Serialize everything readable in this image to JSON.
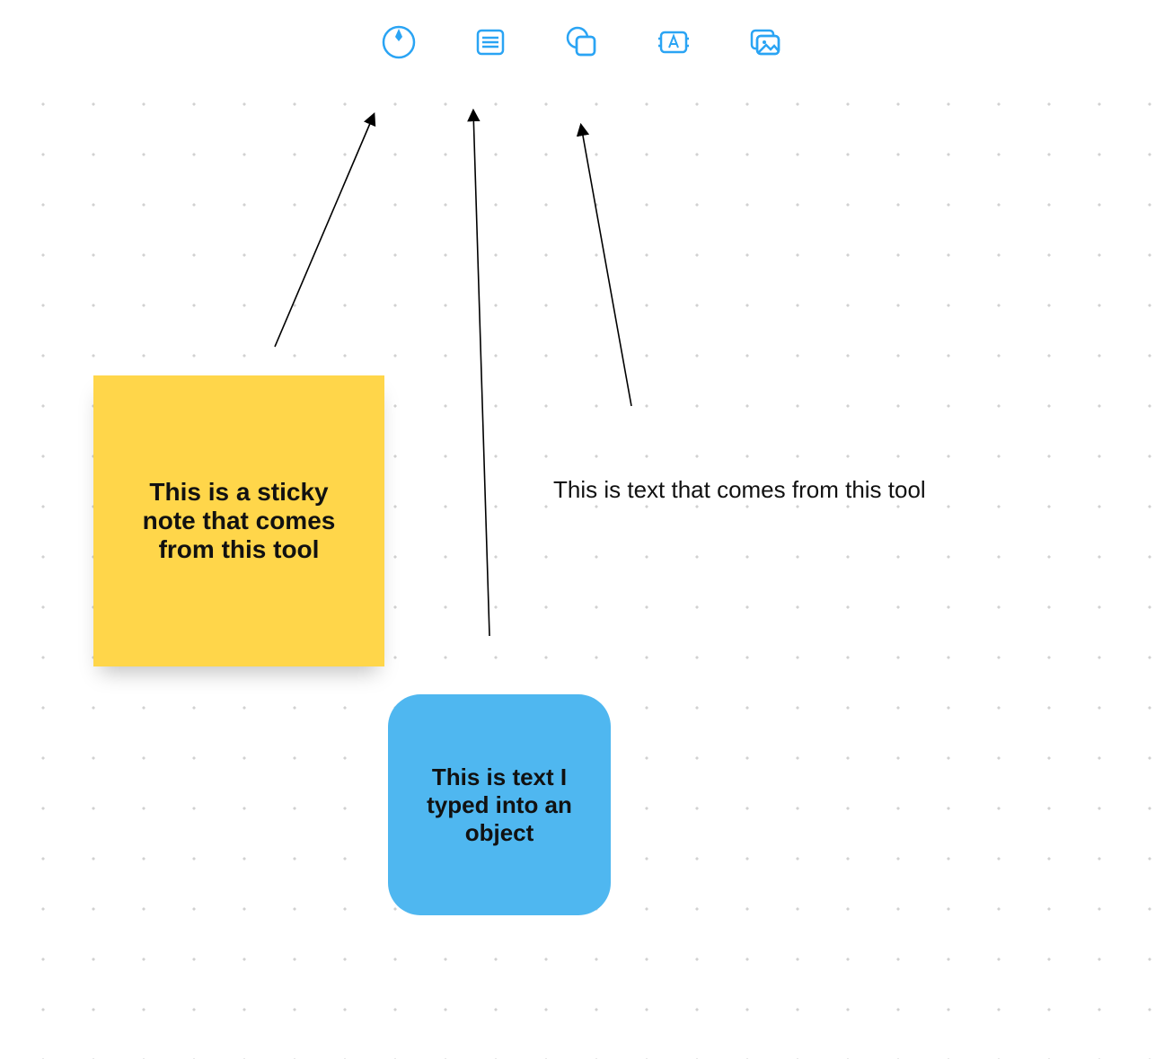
{
  "toolbar": {
    "tools": [
      {
        "name": "pen-tool",
        "icon": "pen"
      },
      {
        "name": "sticky-tool",
        "icon": "sticky"
      },
      {
        "name": "shape-tool",
        "icon": "shape"
      },
      {
        "name": "text-tool",
        "icon": "text"
      },
      {
        "name": "image-tool",
        "icon": "image"
      }
    ]
  },
  "canvas": {
    "sticky_note_text": "This is a sticky note that comes from this tool",
    "shape_text": "This is text I typed into an object",
    "text_block_text": "This is text that comes from this tool"
  },
  "colors": {
    "accent": "#2aa4f4",
    "sticky": "#ffd64a",
    "shape": "#4fb7f0"
  }
}
